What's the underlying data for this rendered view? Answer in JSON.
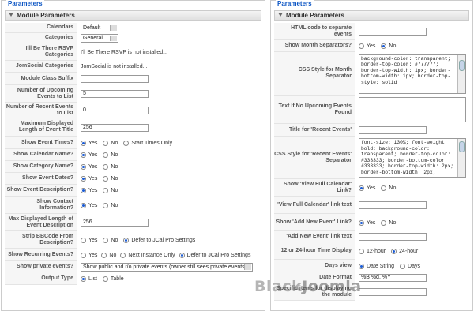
{
  "left": {
    "legend": "Parameters",
    "header": "Module Parameters",
    "calendars": {
      "label": "Calendars",
      "value": "Default"
    },
    "categories": {
      "label": "Categories",
      "value": "General"
    },
    "rsvp": {
      "label": "I'll Be There RSVP Categories",
      "text": "I'll Be There RSVP is not installed..."
    },
    "jomsocial": {
      "label": "JomSocial Categories",
      "text": "JomSocial is not installed..."
    },
    "suffix": {
      "label": "Module Class Suffix",
      "value": ""
    },
    "upcoming": {
      "label": "Number of Upcoming Events to List",
      "value": "5"
    },
    "recent": {
      "label": "Number of Recent Events to List",
      "value": "0"
    },
    "maxlen": {
      "label": "Maximum Displayed Length of Event Title",
      "value": "256"
    },
    "times": {
      "label": "Show Event Times?",
      "o1": "Yes",
      "o2": "No",
      "o3": "Start Times Only"
    },
    "calname": {
      "label": "Show Calendar Name?",
      "o1": "Yes",
      "o2": "No"
    },
    "catname": {
      "label": "Show Category Name?",
      "o1": "Yes",
      "o2": "No"
    },
    "dates": {
      "label": "Show Event Dates?",
      "o1": "Yes",
      "o2": "No"
    },
    "desc": {
      "label": "Show Event Description?",
      "o1": "Yes",
      "o2": "No"
    },
    "contact": {
      "label": "Show Contact Information?",
      "o1": "Yes",
      "o2": "No"
    },
    "desclen": {
      "label": "Max Displayed Length of Event Description",
      "value": "256"
    },
    "bbcode": {
      "label": "Strip BBCode From Description?",
      "o1": "Yes",
      "o2": "No",
      "o3": "Defer to JCal Pro Settings"
    },
    "recurring": {
      "label": "Show Recurring Events?",
      "o1": "Yes",
      "o2": "No",
      "o3": "Next Instance Only",
      "o4": "Defer to JCal Pro Settings"
    },
    "private": {
      "label": "Show private events?",
      "value": "Show public and r/o private events (owner still sees private events)"
    },
    "output": {
      "label": "Output Type",
      "o1": "List",
      "o2": "Table"
    }
  },
  "right": {
    "legend": "Parameters",
    "header": "Module Parameters",
    "html_sep": {
      "label": "HTML code to separate events",
      "value": ""
    },
    "month_sep": {
      "label": "Show Month Separators?",
      "o1": "Yes",
      "o2": "No"
    },
    "month_css": {
      "label": "CSS Style for Month Separator",
      "value": "background-color: transparent; border-top-color: #777777; border-top-width: 1px; border-bottom-width: 1px; border-top-style: solid"
    },
    "no_upcoming": {
      "label": "Text If No Upcoming Events Found",
      "value": ""
    },
    "recent_title": {
      "label": "Title for 'Recent Events'",
      "value": ""
    },
    "recent_css": {
      "label": "CSS Style for 'Recent Events' Separator",
      "value": "font-size: 130%; font-weight: bold; background-color: transparent; border-top-color: #333333; border-bottom-color: #333333; border-top-width: 2px; border-bottom-width: 2px;"
    },
    "full_cal": {
      "label": "Show 'View Full Calendar' Link?",
      "o1": "Yes",
      "o2": "No"
    },
    "full_cal_text": {
      "label": "'View Full Calendar' link text",
      "value": ""
    },
    "add_event": {
      "label": "Show 'Add New Event' Link?",
      "o1": "Yes",
      "o2": "No"
    },
    "add_event_text": {
      "label": "'Add New Event' link text",
      "value": ""
    },
    "time_display": {
      "label": "12 or 24-hour Time Display",
      "o1": "12-hour",
      "o2": "24-hour"
    },
    "days_view": {
      "label": "Days view",
      "o1": "Date String",
      "o2": "Days"
    },
    "date_format": {
      "label": "Date Format",
      "value": "%B %d, %Y"
    },
    "specific": {
      "label": "Specific items for displaying the module",
      "value": ""
    }
  },
  "watermark": {
    "a": "Black",
    "b": "Joomla"
  }
}
